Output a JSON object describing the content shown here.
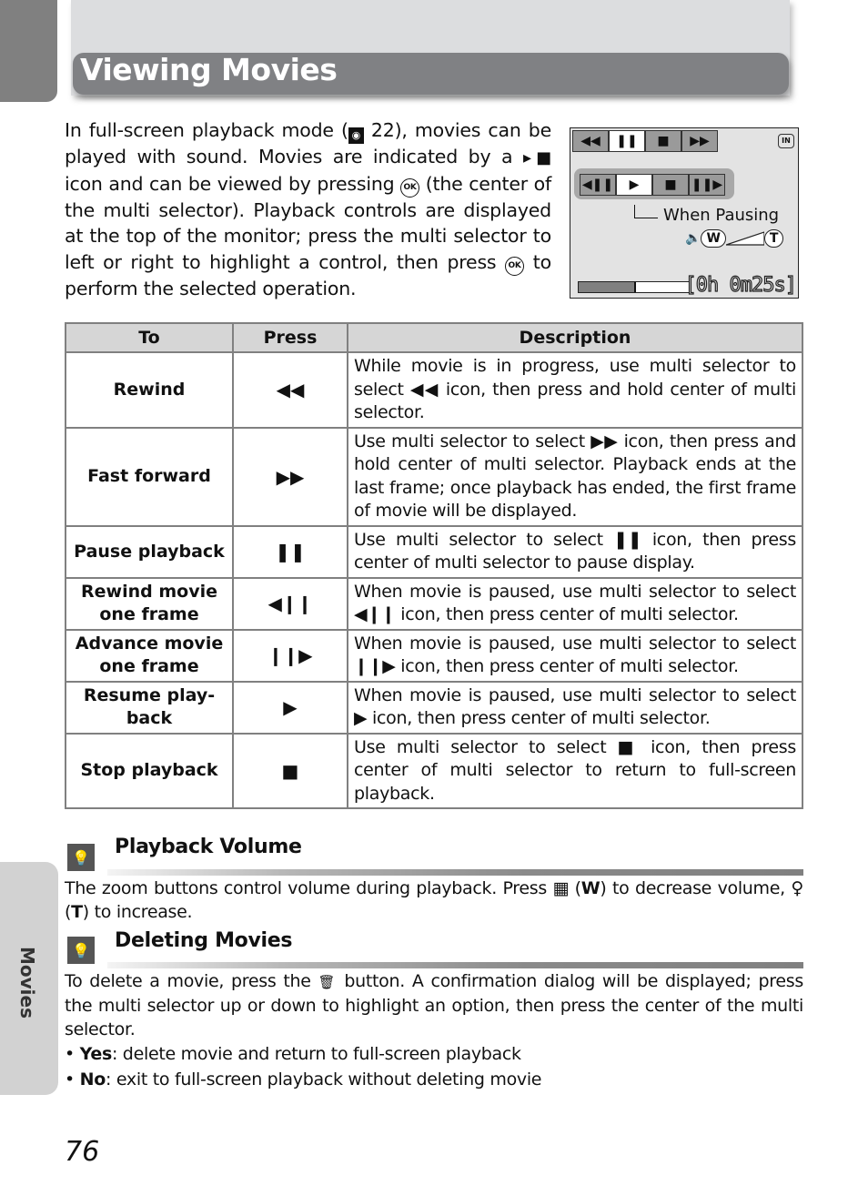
{
  "header": {
    "title": "Viewing Movies"
  },
  "intro": {
    "part1": "In full-screen playback mode (",
    "playback_icon": "playback-mode-icon",
    "page_ref": " 22), movies can be played with sound. Movies are indicated by a ",
    "movie_icon": "movie-icon",
    "part2": " icon and can be viewed by pressing ",
    "ok_label": "OK",
    "part3": " (the center of the multi selector). Playback controls are displayed at the top of the monitor; press the multi selector to left or right to highlight a control, then press ",
    "part4": " to perform the selected operation."
  },
  "monitor": {
    "top_controls": [
      "◀◀",
      "❚❚",
      "■",
      "▶▶"
    ],
    "top_selected": 1,
    "pause_controls": [
      "◀❚❚",
      "▶",
      "■",
      "❚❚▶"
    ],
    "pause_selected": 1,
    "callout_label": "When Pausing",
    "memory_badge": "IN",
    "volume_w": "W",
    "volume_t": "T",
    "progress": 0.5,
    "timer": "[0h 0m25s]"
  },
  "table": {
    "headers": [
      "To",
      "Press",
      "Description"
    ],
    "rows": [
      {
        "to": "Rewind",
        "press": "◀◀",
        "desc": "While movie is in progress, use multi selector to select ◀◀ icon, then press and hold center of multi selector."
      },
      {
        "to": "Fast forward",
        "press": "▶▶",
        "desc": "Use multi selector to select ▶▶ icon, then press and hold center of multi selector. Playback ends at the last frame; once playback has ended, the first frame of movie will be displayed."
      },
      {
        "to": "Pause playback",
        "press": "❚❚",
        "desc": "Use multi selector to select ❚❚ icon, then press center of multi selector to pause display."
      },
      {
        "to": "Rewind movie one frame",
        "press": "◀❙❙",
        "desc": "When movie is paused, use multi selector to select ◀❙❙ icon, then press center of multi selector."
      },
      {
        "to": "Advance movie one frame",
        "press": "❙❙▶",
        "desc": "When movie is paused, use multi selector to select ❙❙▶ icon, then press center of multi selector."
      },
      {
        "to": "Resume play-back",
        "press": "▶",
        "desc": "When movie is paused, use multi selector to select ▶ icon, then press center of multi selector."
      },
      {
        "to": "Stop playback",
        "press": "■",
        "desc": "Use multi selector to select ■ icon, then press center of multi selector to return to full-screen playback."
      }
    ]
  },
  "sections": {
    "volume": {
      "title": "Playback Volume",
      "text1": "The zoom buttons control volume during playback. Press ",
      "w_icon": "▦",
      "w_key": "W",
      "text2": ") to decrease volume, ",
      "t_icon": "♀",
      "t_key": "T",
      "text3": ") to increase."
    },
    "delete": {
      "title": "Deleting Movies",
      "text1": "To delete a movie, press the ",
      "trash_icon": "🗑",
      "text2": " button. A confirmation dialog will be displayed; press the multi selector up or down to highlight an option, then press the center of the multi selector.",
      "bullets": [
        {
          "key": "Yes",
          "text": ": delete movie and return to full-screen playback"
        },
        {
          "key": "No",
          "text": ": exit to full-screen playback without deleting movie"
        }
      ]
    }
  },
  "side_tab": {
    "label": "Movies"
  },
  "page_number": "76"
}
